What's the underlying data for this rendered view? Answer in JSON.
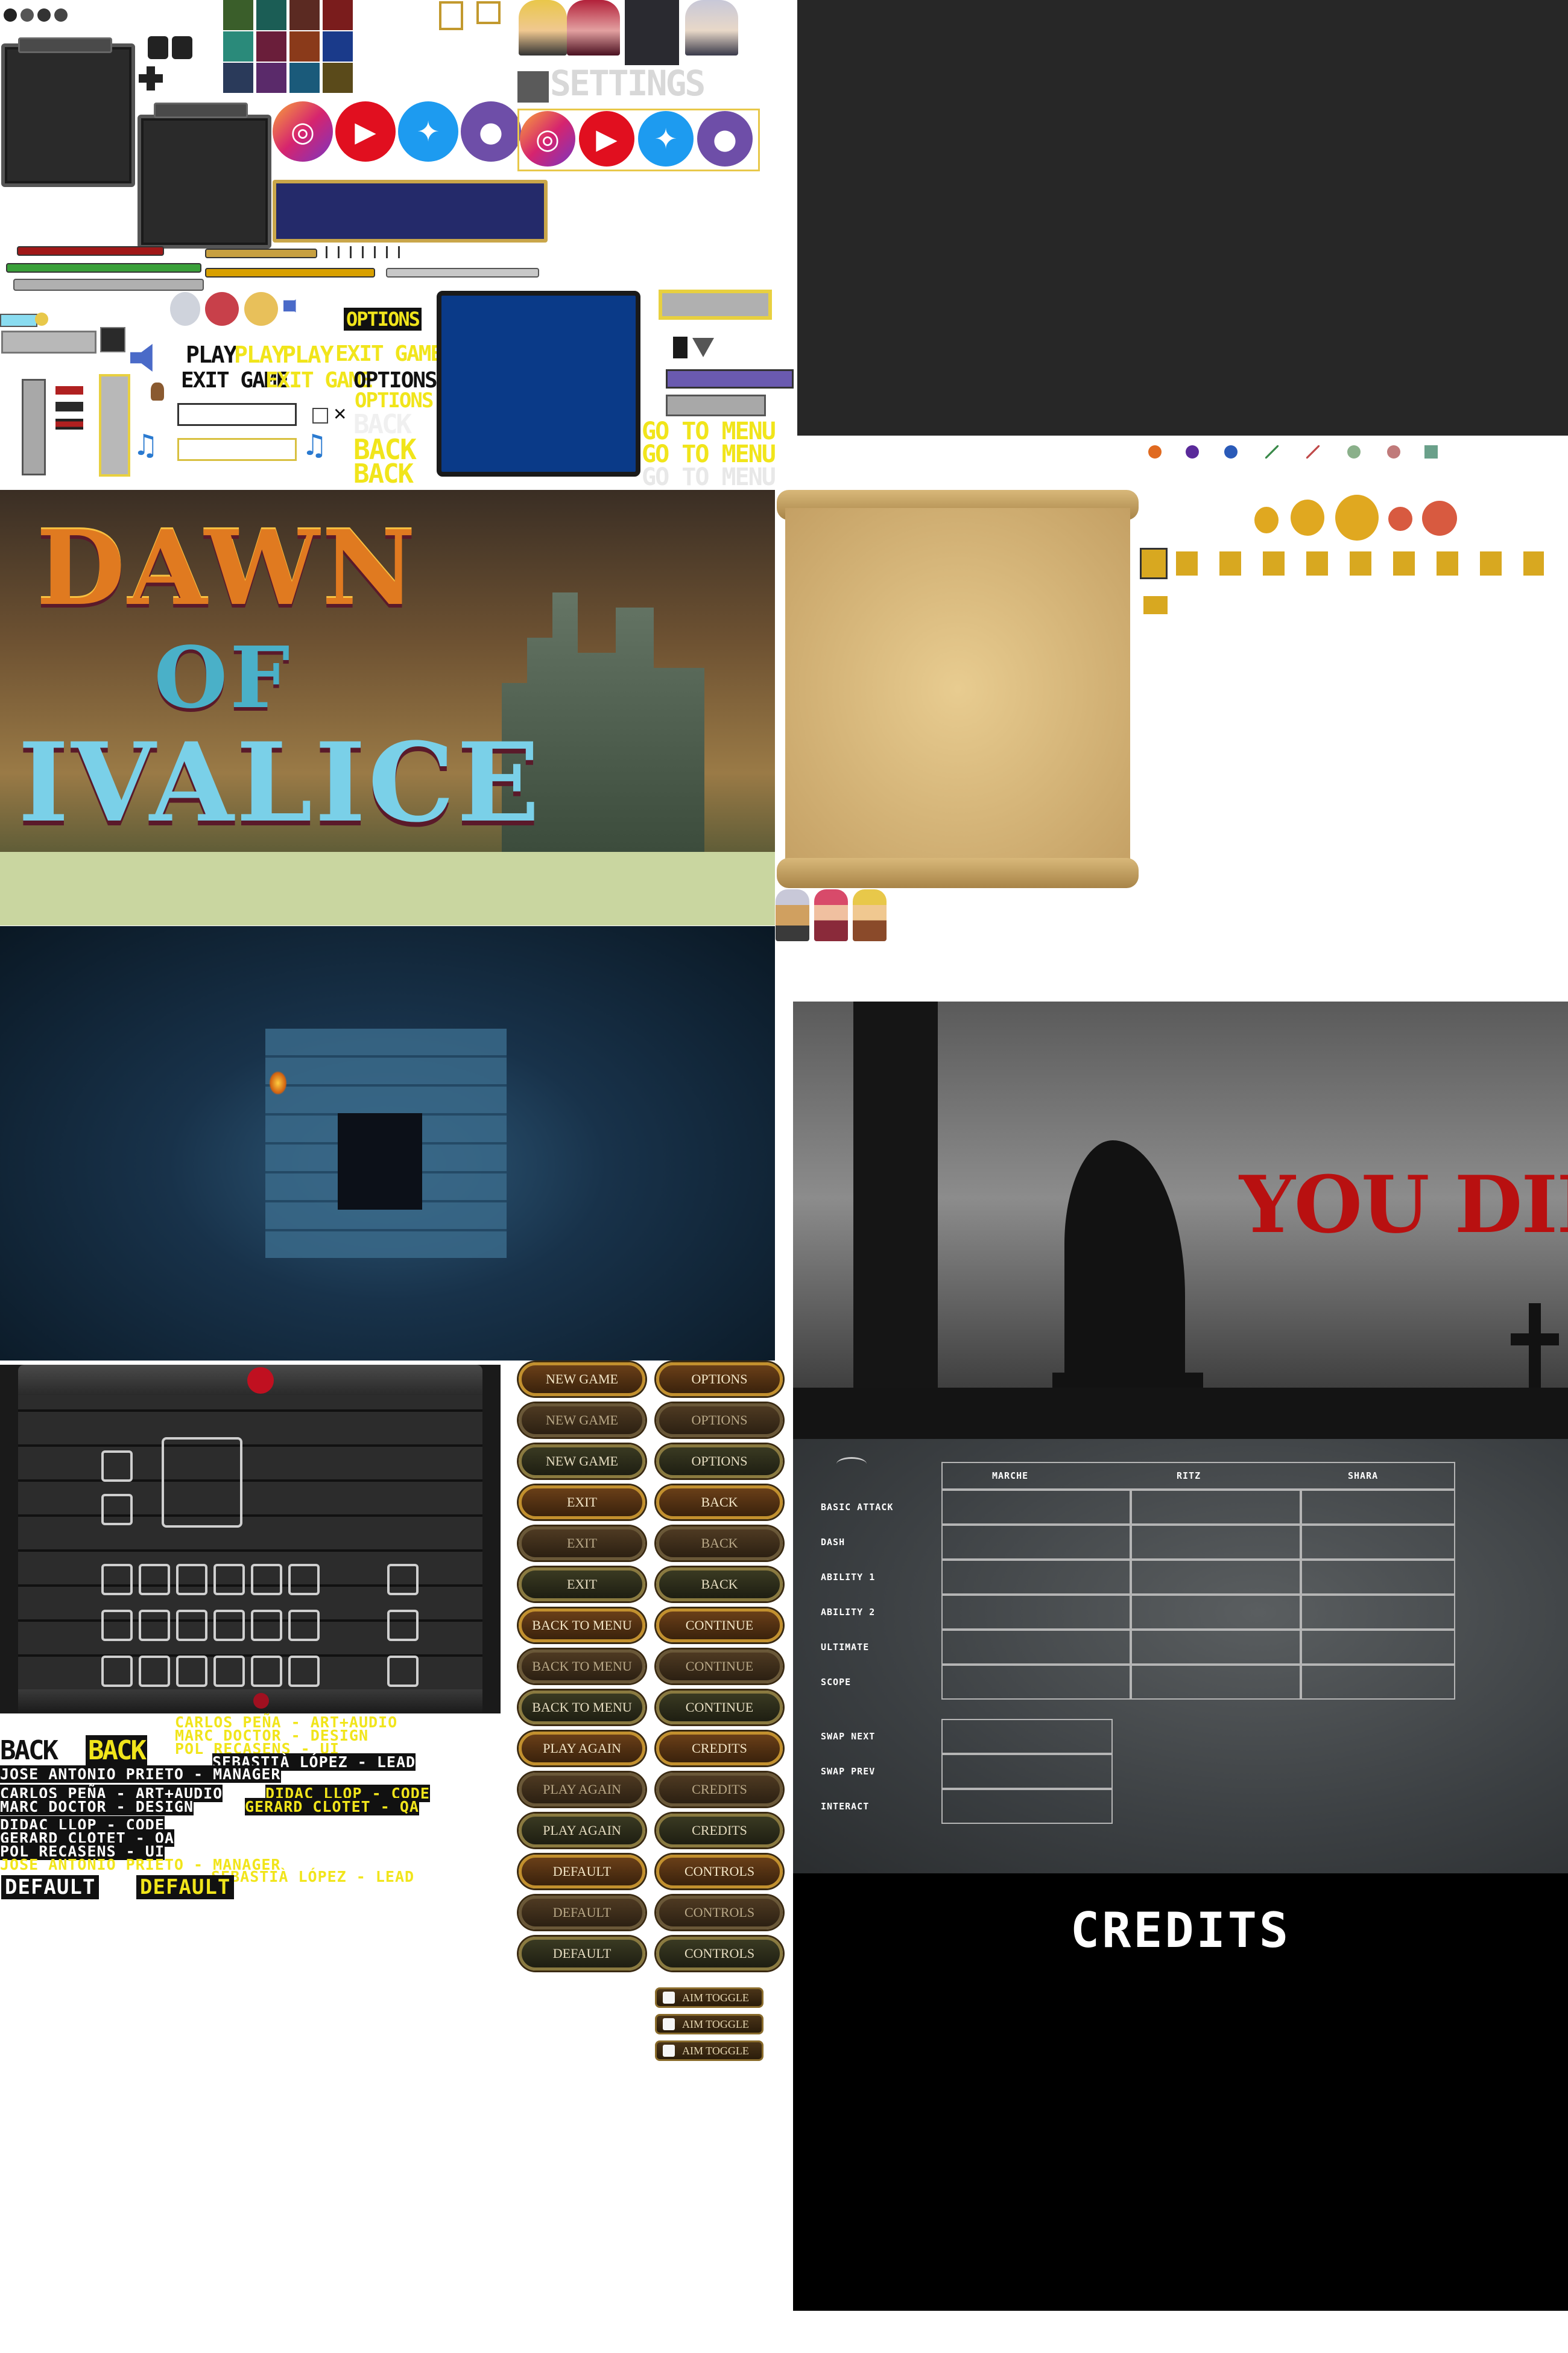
{
  "sheet": {
    "settings_title": "SETTINGS",
    "social_icons": [
      {
        "name": "instagram-icon",
        "glyph": "◎",
        "color": "#d6246e"
      },
      {
        "name": "youtube-icon",
        "glyph": "▶",
        "color": "#e10f1f"
      },
      {
        "name": "twitter-icon",
        "glyph": "🐦",
        "color": "#1d9bf0"
      },
      {
        "name": "github-icon",
        "glyph": "●",
        "color": "#6e4ea8"
      }
    ],
    "yellow_labels": {
      "options": "OPTIONS",
      "play": "PLAY",
      "play2": "PLAY",
      "play3": "PLAY",
      "exit1": "EXIT GAME",
      "exit2": "EXIT GAME",
      "exit3": "EXIT GAME",
      "options2": "OPTIONS",
      "options3": "OPTIONS",
      "back1": "BACK",
      "back2": "BACK",
      "back3": "BACK",
      "goto1": "GO TO MENU",
      "goto2": "GO TO MENU",
      "goto3": "GO TO MENU"
    }
  },
  "title_screen": {
    "line1": "DAWN",
    "line2": "OF",
    "line3": "IVALICE"
  },
  "death_screen": {
    "message": "YOU DIED"
  },
  "controls": {
    "columns": [
      "MARCHE",
      "RITZ",
      "SHARA"
    ],
    "rows": [
      "BASIC ATTACK",
      "DASH",
      "ABILITY 1",
      "ABILITY 2",
      "ULTIMATE",
      "SCOPE"
    ],
    "extra_rows": [
      "SWAP NEXT",
      "SWAP PREV",
      "INTERACT"
    ]
  },
  "credits_screen": {
    "title": "CREDITS"
  },
  "menu_buttons": [
    [
      "NEW GAME",
      "OPTIONS"
    ],
    [
      "NEW GAME",
      "OPTIONS"
    ],
    [
      "NEW GAME",
      "OPTIONS"
    ],
    [
      "EXIT",
      "BACK"
    ],
    [
      "EXIT",
      "BACK"
    ],
    [
      "EXIT",
      "BACK"
    ],
    [
      "BACK TO MENU",
      "CONTINUE"
    ],
    [
      "BACK TO MENU",
      "CONTINUE"
    ],
    [
      "BACK TO MENU",
      "CONTINUE"
    ],
    [
      "PLAY AGAIN",
      "CREDITS"
    ],
    [
      "PLAY AGAIN",
      "CREDITS"
    ],
    [
      "PLAY AGAIN",
      "CREDITS"
    ],
    [
      "DEFAULT",
      "CONTROLS"
    ],
    [
      "DEFAULT",
      "CONTROLS"
    ],
    [
      "DEFAULT",
      "CONTROLS"
    ]
  ],
  "aim_toggle": [
    "AIM TOGGLE",
    "AIM TOGGLE",
    "AIM TOGGLE"
  ],
  "credits_text": {
    "back_black": "BACK",
    "back_yellow": "BACK",
    "y1": "CARLOS PEÑA - ART+AUDIO",
    "y2": "MARC DOCTOR - DESIGN",
    "y3": "POL RECASENS - UI",
    "k1": "SEBASTIÀ LÓPEZ - LEAD",
    "k2": "JOSE ANTONIO PRIETO - MANAGER",
    "k3": "CARLOS PEÑA - ART+AUDIO",
    "k4": "MARC DOCTOR - DESIGN",
    "y4": "DIDAC LLOP - CODE",
    "y5": "GERARD CLOTET - QA",
    "k5": "DIDAC LLOP - CODE",
    "k6": "GERARD CLOTET - QA",
    "k7": "POL RECASENS - UI",
    "y6": "JOSE ANTONIO PRIETO - MANAGER",
    "y7": "SEBASTIÀ LÓPEZ - LEAD",
    "default_black": "DEFAULT",
    "default_yellow": "DEFAULT"
  }
}
